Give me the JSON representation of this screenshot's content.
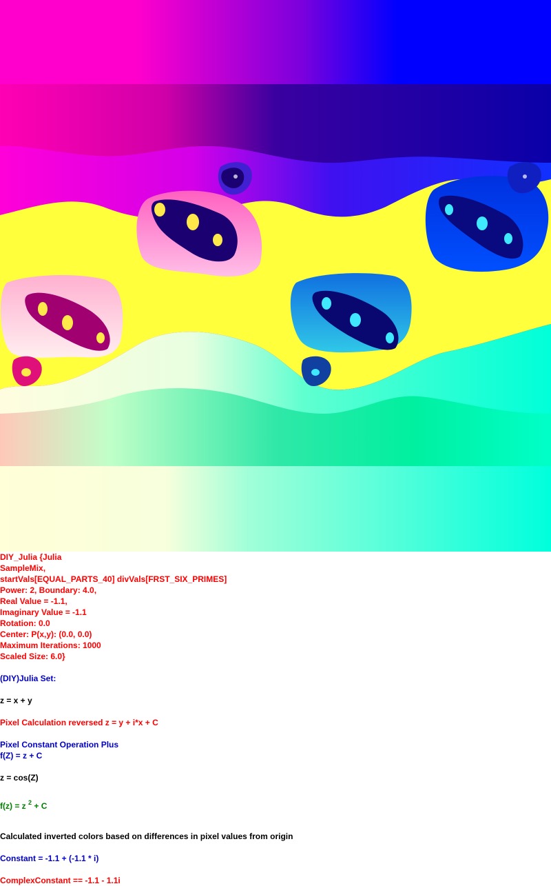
{
  "image": {
    "alt": "Julia set fractal rendering",
    "palette": {
      "magenta": "#ff00cc",
      "purple": "#8a00d8",
      "blue": "#0000ff",
      "navy": "#05009a",
      "yellow": "#ffff3b",
      "cyan": "#00ffe0",
      "green": "#22f598",
      "cream": "#ffffdc",
      "pink": "#ffb6c9"
    }
  },
  "params": {
    "l1": "DIY_Julia {Julia",
    "l2": "SampleMix,",
    "l3": "startVals[EQUAL_PARTS_40] divVals[FRST_SIX_PRIMES]",
    "l4": "Power: 2, Boundary: 4.0,",
    "l5": "Real Value = -1.1,",
    "l6": "Imaginary Value = -1.1",
    "l7": "Rotation: 0.0",
    "l8": "Center: P(x,y): (0.0, 0.0)",
    "l9": "Maximum Iterations: 1000",
    "l10": "Scaled Size: 6.0}"
  },
  "desc": {
    "set_name": "(DIY)Julia Set:",
    "z_def": "z = x + y",
    "pixel_calc": "Pixel Calculation reversed z = y + i*x + C",
    "const_op": "Pixel Constant Operation Plus",
    "fz_plus": "f(Z) = z + C",
    "z_cos": "z = cos(Z)",
    "fz_prefix": "f(z) = z",
    "fz_exp": "2",
    "fz_suffix": " + C",
    "inverted": "Calculated inverted colors based on differences in pixel values from origin",
    "constant": "Constant = -1.1 + (-1.1 * i)",
    "complex_constant": "ComplexConstant == -1.1 - 1.1i"
  }
}
